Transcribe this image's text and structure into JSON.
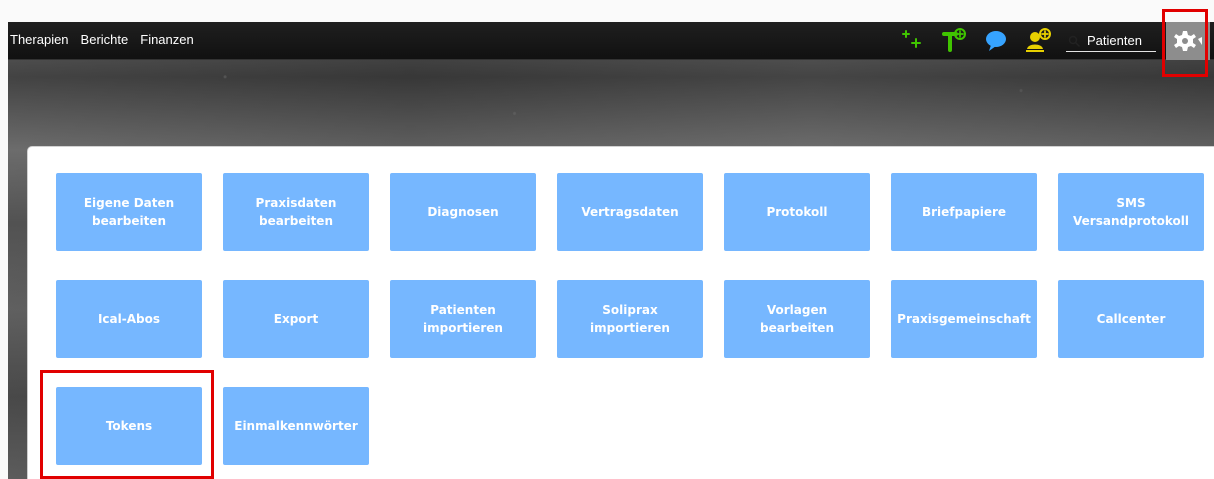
{
  "topbar": {
    "nav_items": [
      {
        "label": "Therapien"
      },
      {
        "label": "Berichte"
      },
      {
        "label": "Finanzen"
      }
    ],
    "actions": [
      {
        "icon": "add-plus-icon"
      },
      {
        "icon": "therapy-add-icon"
      },
      {
        "icon": "chat-bubble-icon"
      },
      {
        "icon": "user-add-icon"
      }
    ],
    "search": {
      "placeholder": "Patienten",
      "value": ""
    },
    "settings": {
      "icon": "gear-icon"
    }
  },
  "menu": {
    "tiles": [
      {
        "label": "Eigene Daten\nbearbeiten"
      },
      {
        "label": "Praxisdaten\nbearbeiten"
      },
      {
        "label": "Diagnosen"
      },
      {
        "label": "Vertragsdaten"
      },
      {
        "label": "Protokoll"
      },
      {
        "label": "Briefpapiere"
      },
      {
        "label": "SMS\nVersandprotokoll"
      },
      {
        "label": "Ical-Abos"
      },
      {
        "label": "Export"
      },
      {
        "label": "Patienten\nimportieren"
      },
      {
        "label": "Soliprax importieren"
      },
      {
        "label": "Vorlagen bearbeiten"
      },
      {
        "label": "Praxisgemeinschaft"
      },
      {
        "label": "Callcenter"
      },
      {
        "label": "Tokens"
      },
      {
        "label": "Einmalkennwörter"
      }
    ]
  },
  "colors": {
    "tile_background": "#76b7ff",
    "highlight": "#e10000",
    "accent_green": "#40c400",
    "chat_blue": "#36a3ff",
    "user_yellow": "#e7d000"
  }
}
